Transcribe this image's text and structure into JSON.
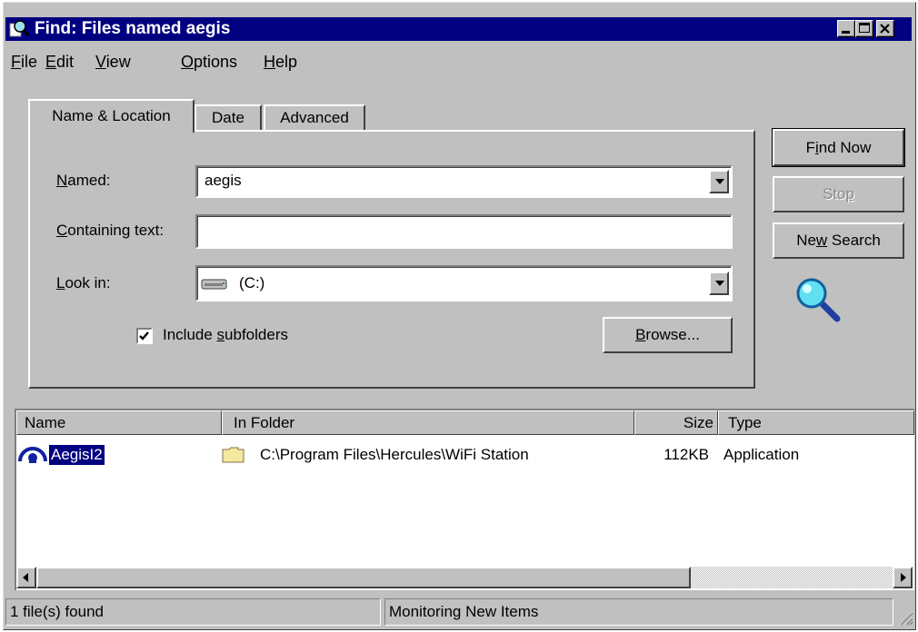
{
  "window": {
    "title": "Find: Files named aegis"
  },
  "menu": {
    "items": [
      {
        "label": "File",
        "accel": "F",
        "rest": "ile"
      },
      {
        "label": "Edit",
        "accel": "E",
        "rest": "dit"
      },
      {
        "label": "View",
        "accel": "V",
        "rest": "iew"
      },
      {
        "label": "Options",
        "accel": "O",
        "rest": "ptions"
      },
      {
        "label": "Help",
        "accel": "H",
        "rest": "elp"
      }
    ]
  },
  "tabs": [
    {
      "label": "Name & Location",
      "active": true
    },
    {
      "label": "Date",
      "active": false
    },
    {
      "label": "Advanced",
      "active": false
    }
  ],
  "form": {
    "named_label": {
      "accel": "N",
      "rest": "amed:"
    },
    "named_value": "aegis",
    "containing_label": {
      "accel": "C",
      "rest": "ontaining text:"
    },
    "containing_value": "",
    "lookin_label": {
      "accel": "L",
      "rest": "ook in:"
    },
    "lookin_value": "(C:)",
    "include_subfolders": {
      "pre": "Include ",
      "accel": "s",
      "rest": "ubfolders",
      "checked": true
    },
    "browse_button": {
      "accel": "B",
      "rest": "rowse..."
    }
  },
  "actions": {
    "find_now": {
      "pre": "F",
      "accel": "i",
      "rest": "nd Now"
    },
    "stop": {
      "pre": "Sto",
      "accel": "p",
      "rest": ""
    },
    "new_search": {
      "pre": "Ne",
      "accel": "w",
      "rest": " Search"
    }
  },
  "results": {
    "columns": [
      "Name",
      "In Folder",
      "Size",
      "Type"
    ],
    "rows": [
      {
        "name": "AegisI2",
        "folder": "C:\\Program Files\\Hercules\\WiFi Station",
        "size": "112KB",
        "type": "Application",
        "selected": true
      }
    ]
  },
  "status": {
    "found": "1 file(s) found",
    "monitoring": "Monitoring New Items"
  },
  "colors": {
    "titlebar": "#000080",
    "face": "#c0c0c0",
    "selection": "#000080"
  }
}
